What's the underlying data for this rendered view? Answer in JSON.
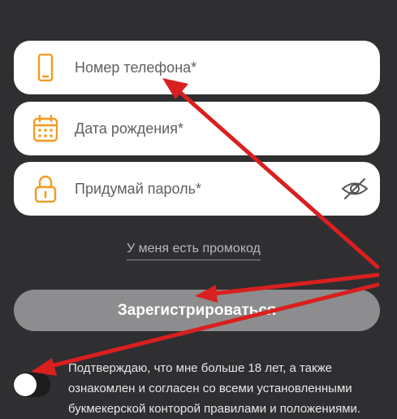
{
  "form": {
    "phone": {
      "placeholder": "Номер телефона*",
      "icon": "phone-icon"
    },
    "birthdate": {
      "placeholder": "Дата рождения*",
      "icon": "calendar-icon"
    },
    "password": {
      "placeholder": "Придумай пароль*",
      "icon": "lock-icon",
      "toggle_icon": "eye-off-icon"
    },
    "promo_link": "У меня есть промокод",
    "register_label": "Зарегистрироваться",
    "consent_toggle_on": false,
    "consent_text": "Подтверждаю, что мне больше 18 лет, а также ознакомлен и согласен со всеми установленными букмекерской конторой правилами и положениями."
  },
  "colors": {
    "background": "#2f2f32",
    "accent_icon": "#f39a1e",
    "button": "#8d8d8f",
    "annotation_arrow": "#d91f1f"
  }
}
